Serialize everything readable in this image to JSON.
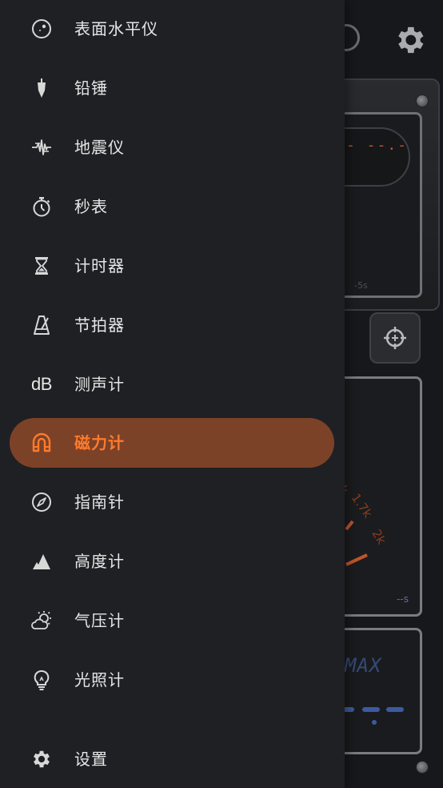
{
  "background": {
    "readout_dashes": "- --.-",
    "time_axis_label": "-5s",
    "dial_scale_labels": [
      "1.7k",
      "2k",
      "k"
    ],
    "time_unit": "--s",
    "max_label": "MAX",
    "accent_colors": {
      "orange": "#c0552a",
      "blue": "#3c5aa0"
    }
  },
  "drawer": {
    "items": [
      {
        "label": "表面水平仪",
        "icon": "surface-level-icon"
      },
      {
        "label": "铅锤",
        "icon": "plumb-bob-icon"
      },
      {
        "label": "地震仪",
        "icon": "seismometer-icon"
      },
      {
        "label": "秒表",
        "icon": "stopwatch-icon"
      },
      {
        "label": "计时器",
        "icon": "hourglass-icon"
      },
      {
        "label": "节拍器",
        "icon": "metronome-icon"
      },
      {
        "label": "测声计",
        "icon": "db-icon",
        "icon_text": "dB"
      },
      {
        "label": "磁力计",
        "icon": "magnet-icon",
        "active": true
      },
      {
        "label": "指南针",
        "icon": "compass-icon"
      },
      {
        "label": "高度计",
        "icon": "altitude-icon"
      },
      {
        "label": "气压计",
        "icon": "weather-icon"
      },
      {
        "label": "光照计",
        "icon": "lightbulb-icon"
      }
    ],
    "settings": {
      "label": "设置",
      "icon": "gear-icon"
    },
    "colors": {
      "active_bg": "#7c4228",
      "active_text": "#ff7a2c",
      "text": "#e6e6e6",
      "icon": "#d8d8d8"
    }
  }
}
